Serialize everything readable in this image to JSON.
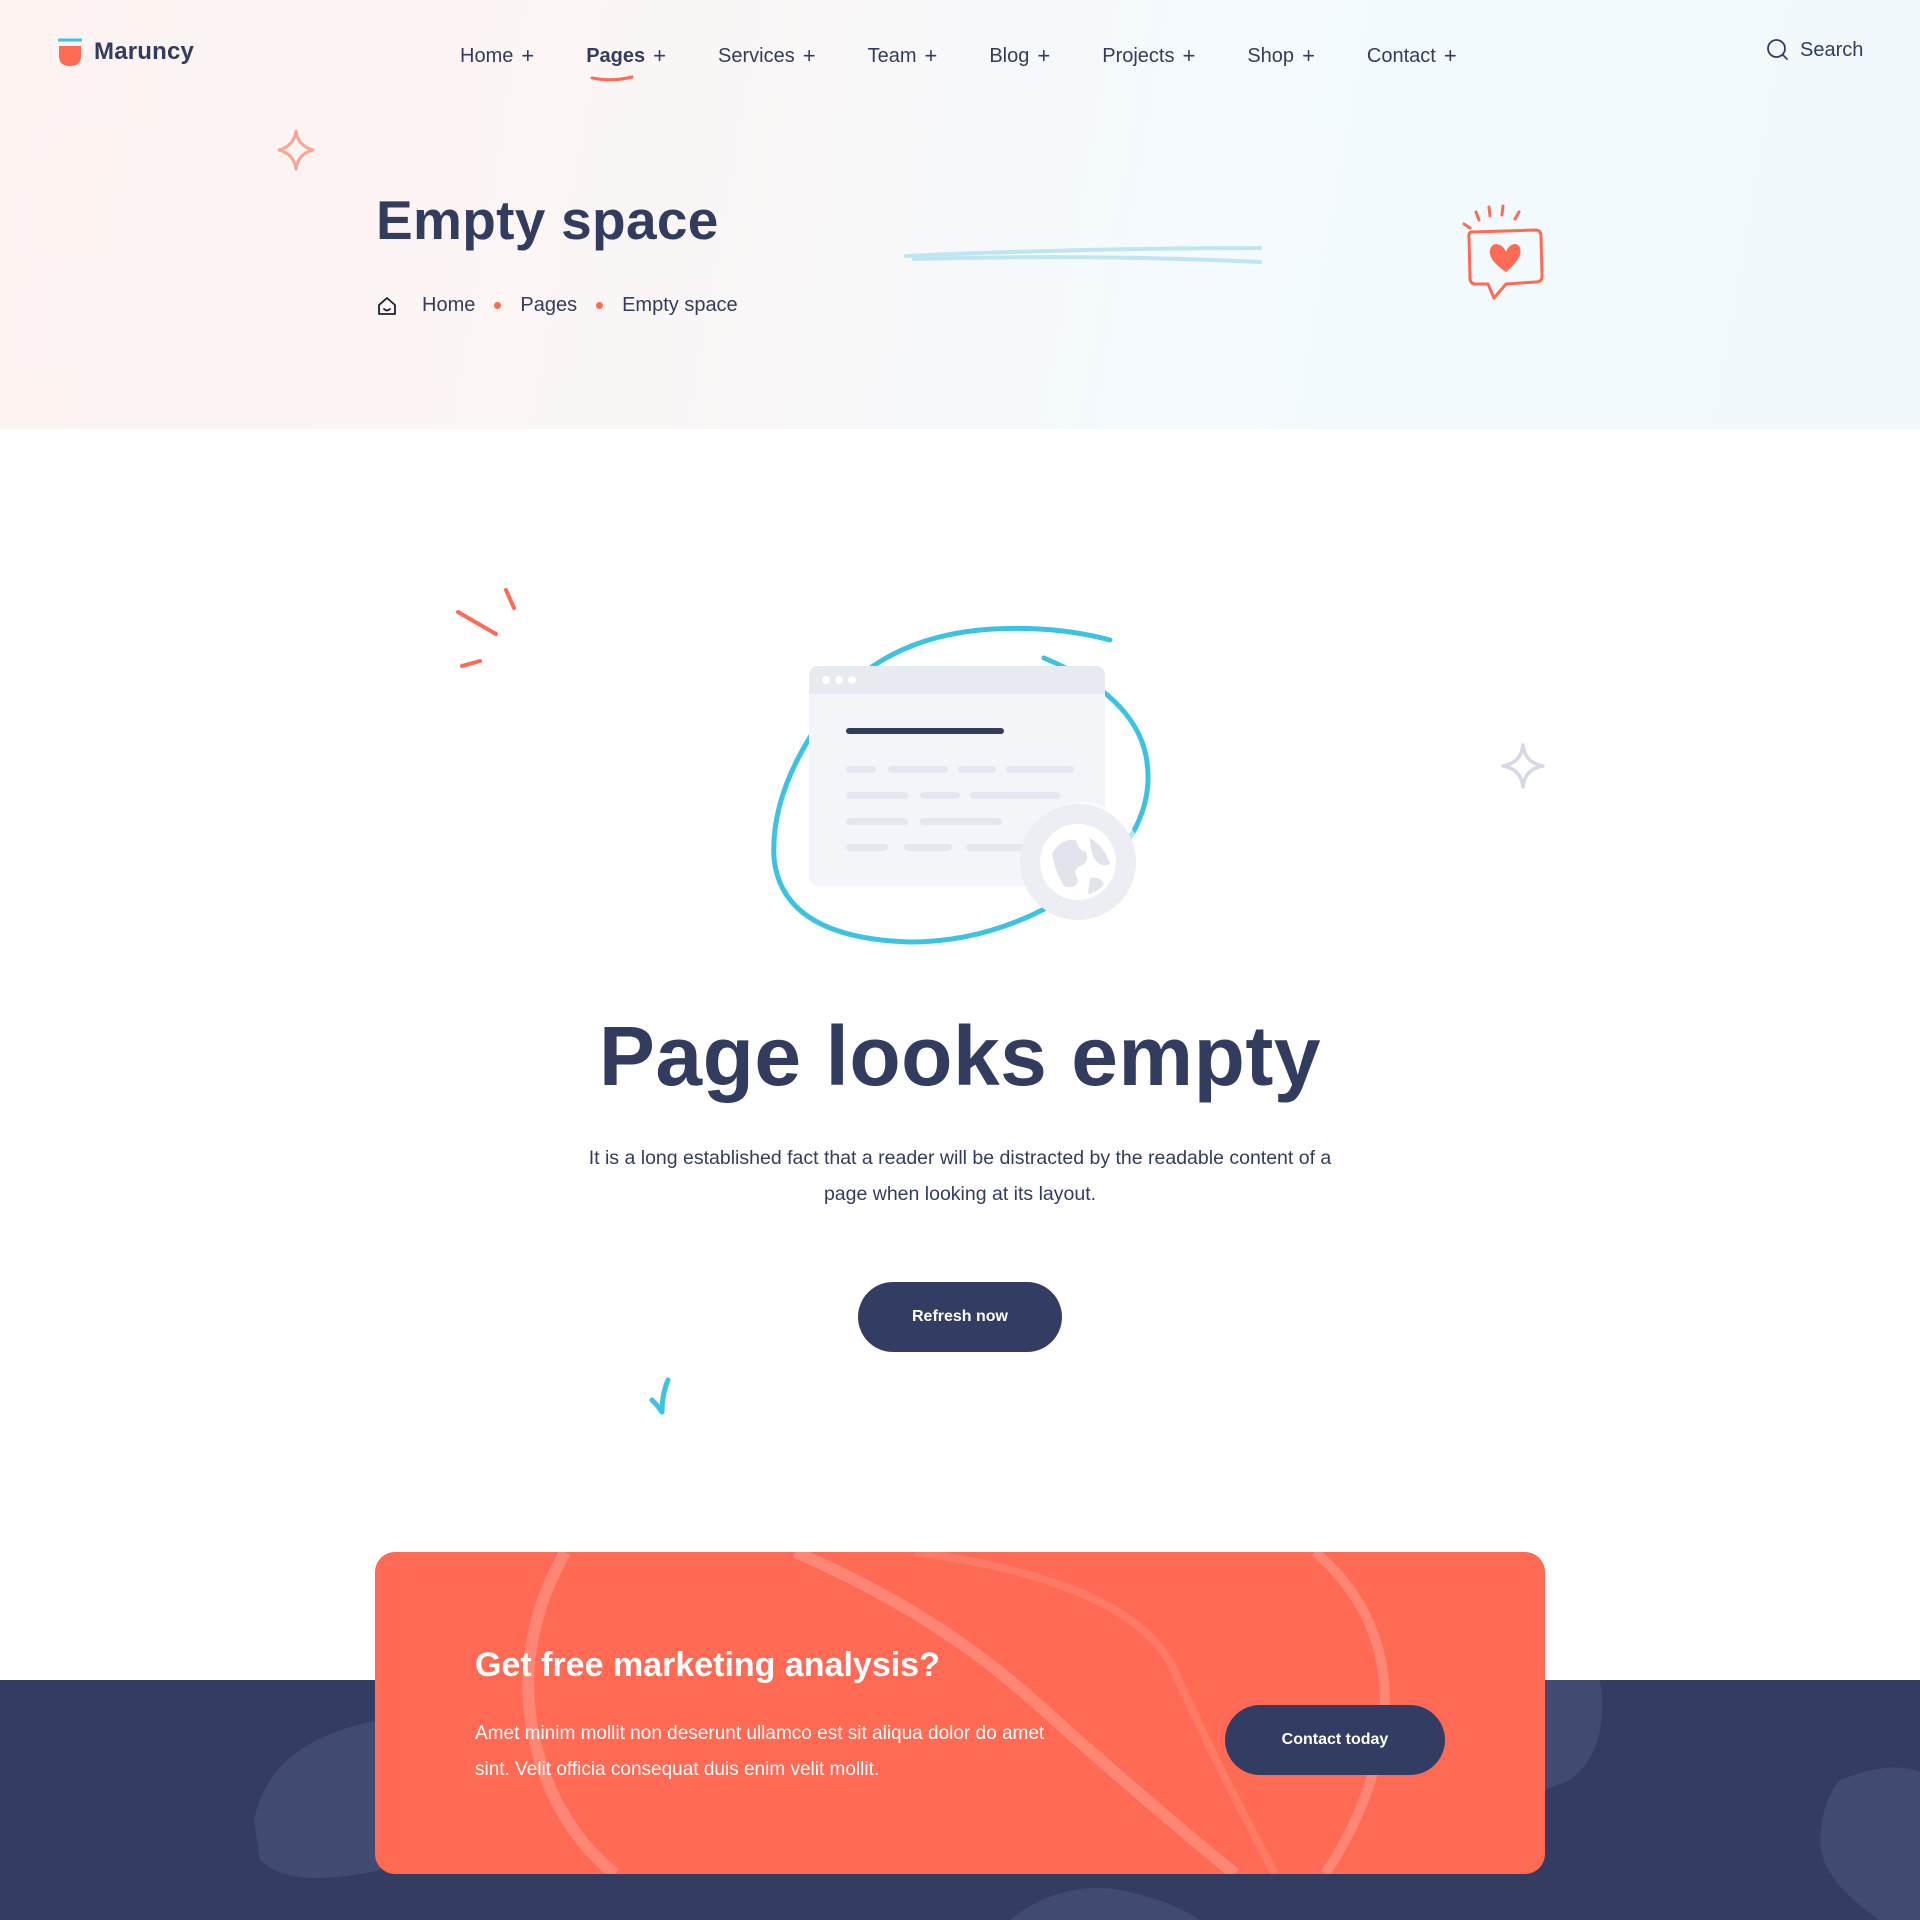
{
  "brand": {
    "name": "Maruncy",
    "accent": "#ff6a55",
    "dark": "#323c5f",
    "cyan": "#3cc2e2"
  },
  "nav": {
    "items": [
      {
        "label": "Home",
        "icon": "plus-icon"
      },
      {
        "label": "Pages",
        "icon": "plus-icon",
        "active": true
      },
      {
        "label": "Services",
        "icon": "plus-icon"
      },
      {
        "label": "Team",
        "icon": "plus-icon"
      },
      {
        "label": "Blog",
        "icon": "plus-icon"
      },
      {
        "label": "Projects",
        "icon": "plus-icon"
      },
      {
        "label": "Shop",
        "icon": "plus-icon"
      },
      {
        "label": "Contact",
        "icon": "plus-icon"
      }
    ],
    "search_label": "Search"
  },
  "hero": {
    "title": "Empty space",
    "breadcrumb": [
      "Home",
      "Pages",
      "Empty space"
    ]
  },
  "main": {
    "title": "Page looks empty",
    "description": "It is a long established fact that a reader will be distracted by the readable content of a page when looking at its layout.",
    "button_label": "Refresh now"
  },
  "cta": {
    "title": "Get free marketing analysis?",
    "description": "Amet minim mollit non deserunt ullamco est sit aliqua dolor do amet sint. Velit officia consequat duis enim velit mollit.",
    "button_label": "Contact today"
  }
}
